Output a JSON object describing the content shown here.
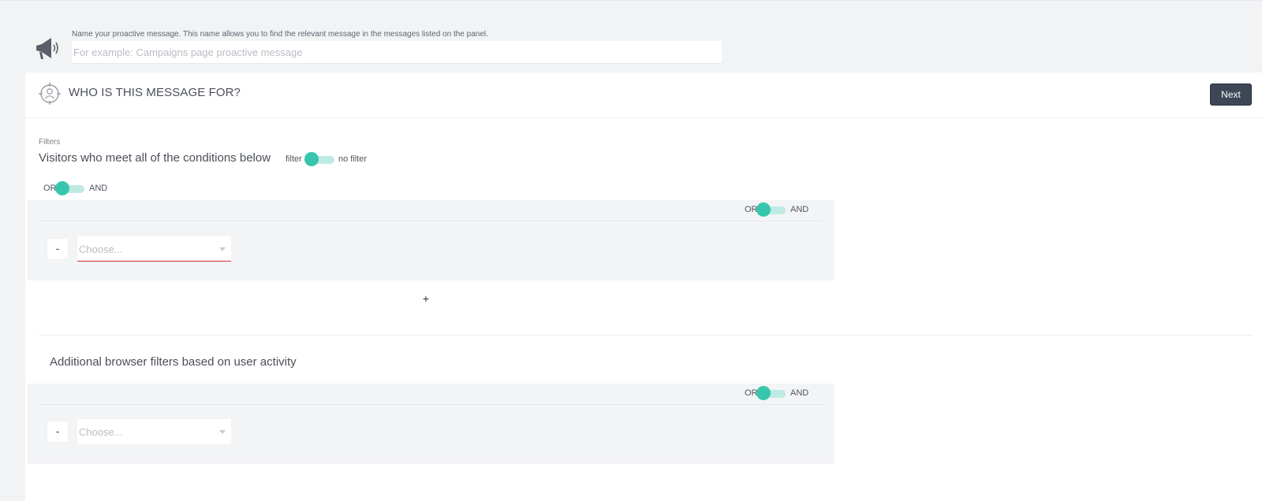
{
  "name_section": {
    "help_text": "Name your proactive message. This name allows you to find the relevant message in the messages listed on the panel.",
    "placeholder": "For example: Campaigns page proactive message",
    "value": ""
  },
  "header": {
    "title": "WHO IS THIS MESSAGE FOR?",
    "next_label": "Next"
  },
  "filters": {
    "label": "Filters",
    "title": "Visitors who meet all of the conditions below",
    "filter_toggle": {
      "left": "filter",
      "right": "no filter"
    },
    "outer_logic": {
      "left": "OR",
      "right": "AND"
    },
    "group1": {
      "logic": {
        "left": "OR",
        "right": "AND"
      },
      "remove_label": "-",
      "select_placeholder": "Choose..."
    },
    "add_label": "+"
  },
  "browser_filters": {
    "title": "Additional browser filters based on user activity",
    "logic": {
      "left": "OR",
      "right": "AND"
    },
    "remove_label": "-",
    "select_placeholder": "Choose..."
  },
  "colors": {
    "accent": "#37c6ad",
    "accent_light": "#bfeae3",
    "button_dark": "#3d4654",
    "error": "#d22a2a"
  },
  "icons": {
    "name": "megaphone-icon",
    "header": "target-user-icon",
    "select_caret": "caret-down-icon"
  }
}
